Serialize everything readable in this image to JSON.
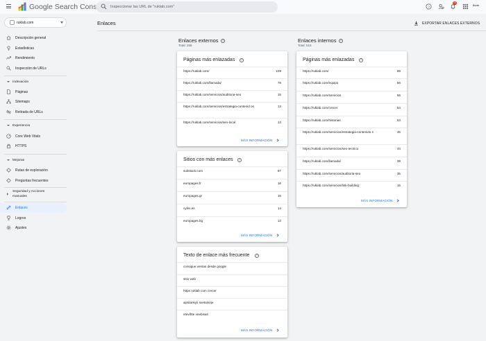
{
  "app": {
    "product_name": "Google Search Console",
    "search_placeholder": "Inspeccionar las URL de \"ruklab.com\"",
    "notification_count": "10",
    "account_label": "Burak",
    "colors": {
      "brand_blue": "#1a73e8",
      "active_bg": "#e8f0fe",
      "badge": "#d93025"
    }
  },
  "sidebar": {
    "property": "ruklab.com",
    "top_items": [
      {
        "label": "Descripción general",
        "icon": "home-icon"
      },
      {
        "label": "Estadísticas",
        "icon": "insights-icon"
      },
      {
        "label": "Rendimiento",
        "icon": "trending-up-icon"
      },
      {
        "label": "Inspección de URLs",
        "icon": "search-icon"
      }
    ],
    "indexing": {
      "title": "Indexación",
      "items": [
        {
          "label": "Páginas",
          "icon": "pages-icon"
        },
        {
          "label": "Sitemaps",
          "icon": "sitemap-icon"
        },
        {
          "label": "Retirada de URLs",
          "icon": "eye-off-icon"
        }
      ]
    },
    "experience": {
      "title": "Experiencia",
      "items": [
        {
          "label": "Core Web Vitals",
          "icon": "gauge-icon"
        },
        {
          "label": "HTTPS",
          "icon": "lock-icon"
        }
      ]
    },
    "enhancements": {
      "title": "Mejoras",
      "items": [
        {
          "label": "Rutas de exploración",
          "icon": "breadcrumb-icon"
        },
        {
          "label": "Preguntas frecuentes",
          "icon": "faq-icon"
        }
      ]
    },
    "security": {
      "title": "Seguridad y Acciones manuales"
    },
    "bottom_items": [
      {
        "label": "Enlaces",
        "icon": "link-icon",
        "active": true
      },
      {
        "label": "Logros",
        "icon": "trophy-icon"
      },
      {
        "label": "Ajustes",
        "icon": "settings-icon"
      }
    ]
  },
  "header": {
    "title": "Enlaces",
    "export_label": "EXPORTAR ENLACES EXTERNOS"
  },
  "external": {
    "title": "Enlaces externos",
    "total": "Total: 258",
    "top_pages": {
      "title": "Páginas más enlazadas",
      "rows": [
        {
          "url": "https://ruklab.com/",
          "count": "109"
        },
        {
          "url": "https://ruklab.com/llamada/",
          "count": "78"
        },
        {
          "url": "https://ruklab.com/servicios/auditoria-seo",
          "count": "15"
        },
        {
          "url": "https://ruklab.com/servicios/estrategia-contenid os",
          "count": "13"
        },
        {
          "url": "https://ruklab.com/servicios/seo-local",
          "count": "13"
        }
      ],
      "more_label": "MÁS INFORMACIÓN"
    },
    "top_sites": {
      "title": "Sitios con más enlaces",
      "rows": [
        {
          "url": "substack.com",
          "count": "87"
        },
        {
          "url": "europages.fr",
          "count": "16"
        },
        {
          "url": "europages.gr",
          "count": "15"
        },
        {
          "url": "cylex.es",
          "count": "14"
        },
        {
          "url": "europages.bg",
          "count": "13"
        }
      ],
      "more_label": "MÁS INFORMACIÓN"
    },
    "anchor_text": {
      "title": "Texto de enlace más frecuente",
      "rows": [
        {
          "text": "consigue ventas desde google"
        },
        {
          "text": "sitio web"
        },
        {
          "text": "https ruklab com crecer"
        },
        {
          "text": "apsilankyti svetainėje"
        },
        {
          "text": "etevõtte veebisait"
        }
      ],
      "more_label": "MÁS INFORMACIÓN"
    }
  },
  "internal": {
    "title": "Enlaces internos",
    "total": "Total: 515",
    "top_pages": {
      "title": "Páginas más enlazadas",
      "rows": [
        {
          "url": "https://ruklab.com/",
          "count": "59"
        },
        {
          "url": "https://ruklab.com/equipo",
          "count": "56"
        },
        {
          "url": "https://ruklab.com/servicios",
          "count": "56"
        },
        {
          "url": "https://ruklab.com/crecer",
          "count": "54"
        },
        {
          "url": "https://ruklab.com/historias",
          "count": "53"
        },
        {
          "url": "https://ruklab.com/servicios/estrategia-contenido s",
          "count": "45"
        },
        {
          "url": "https://ruklab.com/servicios/seo-tecnico",
          "count": "44"
        },
        {
          "url": "https://ruklab.com/llamada/",
          "count": "39"
        },
        {
          "url": "https://ruklab.com/servicios/auditoria-seo",
          "count": "35"
        },
        {
          "url": "https://ruklab.com/servicios/link-building",
          "count": "15"
        }
      ],
      "more_label": "MÁS INFORMACIÓN"
    }
  }
}
